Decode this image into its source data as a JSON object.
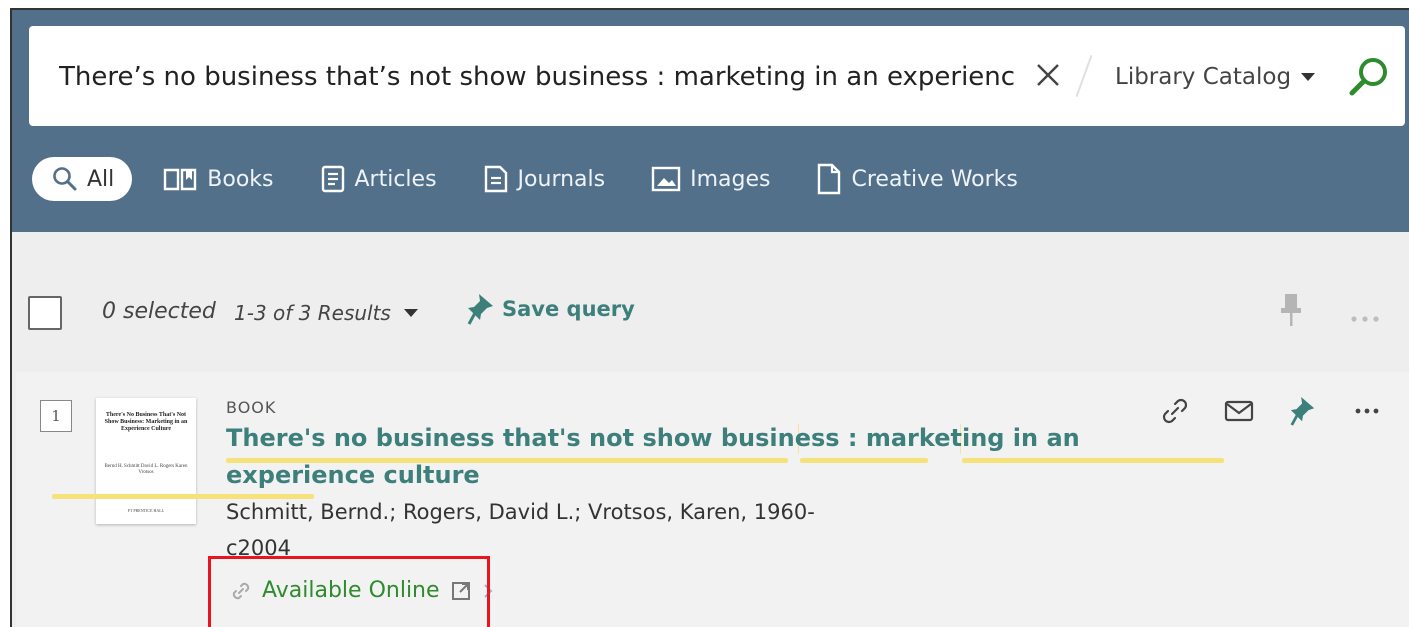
{
  "search": {
    "query": "There’s no business that’s not show business : marketing in an experience culture",
    "scope": "Library Catalog"
  },
  "tabs": [
    {
      "label": "All",
      "icon": "search-icon",
      "active": true
    },
    {
      "label": "Books",
      "icon": "book-icon"
    },
    {
      "label": "Articles",
      "icon": "article-icon"
    },
    {
      "label": "Journals",
      "icon": "journal-icon"
    },
    {
      "label": "Images",
      "icon": "image-icon"
    },
    {
      "label": "Creative Works",
      "icon": "document-icon"
    }
  ],
  "results_bar": {
    "selected": "0 selected",
    "count": "1-3 of 3 Results",
    "save_query": "Save query"
  },
  "result": {
    "index": "1",
    "type": "BOOK",
    "title": "There's no business that's not show business : marketing in an experience culture",
    "authors": "Schmitt, Bernd.; Rogers, David L.; Vrotsos, Karen, 1960-",
    "date": "c2004",
    "availability": "Available Online",
    "thumbnail": {
      "title": "There's No Business That's Not Show Business: Marketing in an Experience Culture",
      "authors": "Bernd H. Schmitt  David L. Rogers  Karen Vrotsos",
      "publisher": "FT PRENTICE HALL"
    }
  },
  "colors": {
    "header_bg": "#53708b",
    "link_teal": "#3c7f7b",
    "available_green": "#2e8b2e",
    "search_green": "#2e8b2e",
    "highlight_yellow": "#f6e27a",
    "annotation_red": "#e8141e"
  }
}
